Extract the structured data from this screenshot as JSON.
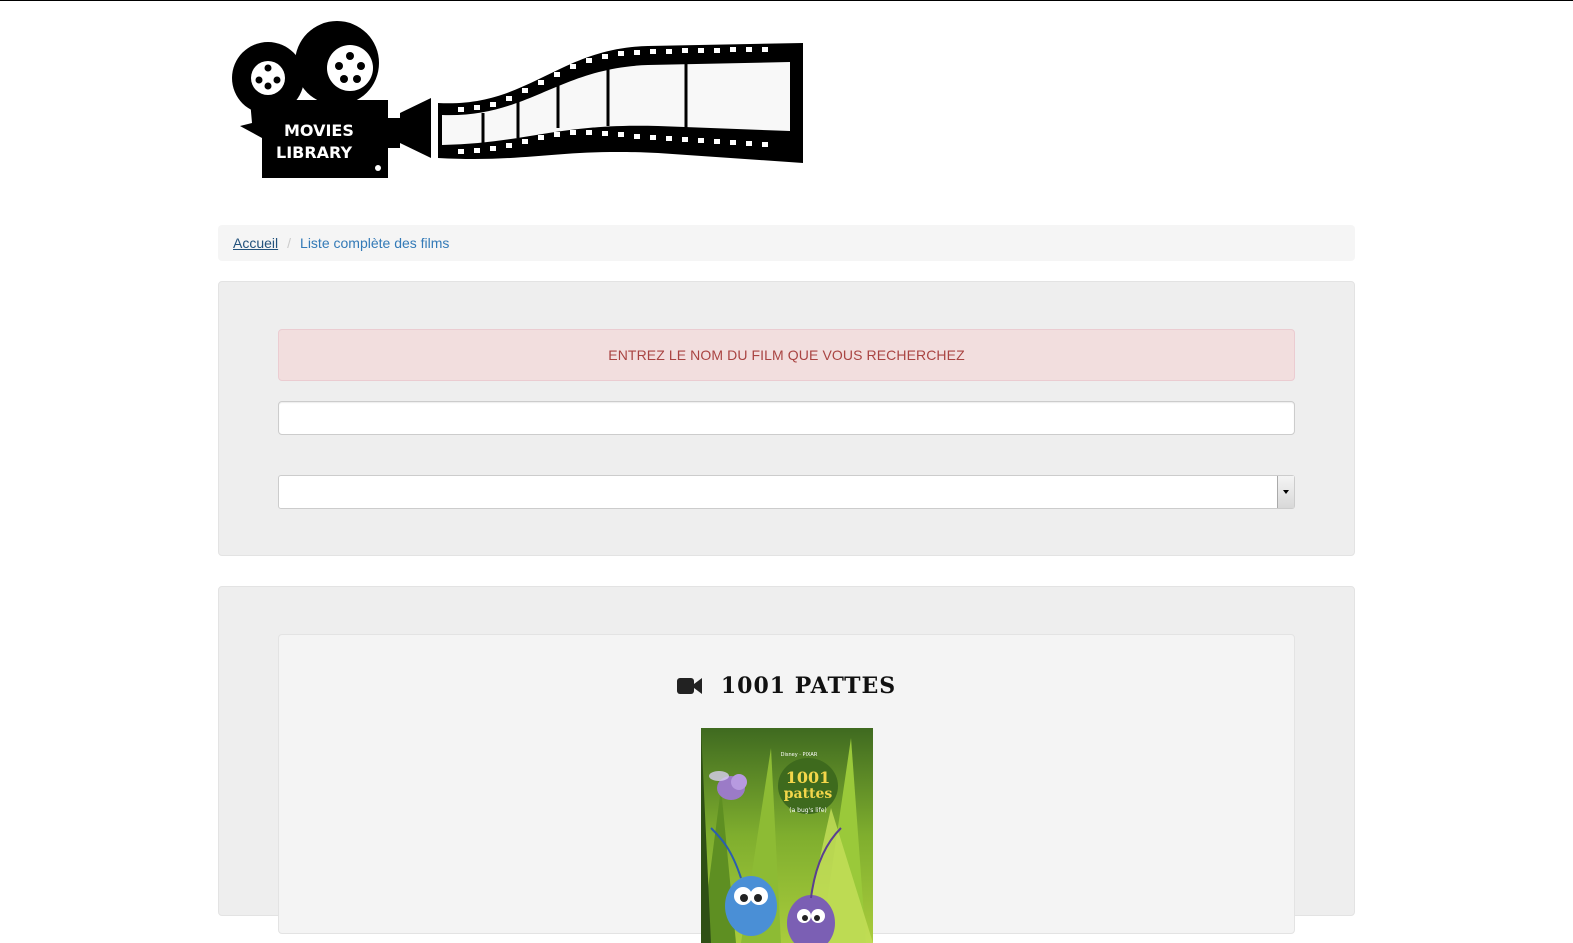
{
  "logo": {
    "line1": "MOVIES",
    "line2": "LIBRARY"
  },
  "breadcrumb": {
    "home": "Accueil",
    "separator": "/",
    "current": "Liste complète des films"
  },
  "search": {
    "prompt": "ENTREZ LE NOM DU FILM QUE VOUS RECHERCHEZ",
    "input_value": "",
    "select_value": ""
  },
  "results": {
    "movies": [
      {
        "title": "1001 PATTES",
        "poster": {
          "studio": "Disney · PIXAR",
          "title_line1": "1001",
          "title_line2": "pattes",
          "subtitle": "(a bug's life)"
        }
      }
    ]
  },
  "colors": {
    "alert_bg": "#f2dede",
    "alert_text": "#a94442",
    "link": "#337ab7",
    "well_bg": "#eeeeee"
  }
}
